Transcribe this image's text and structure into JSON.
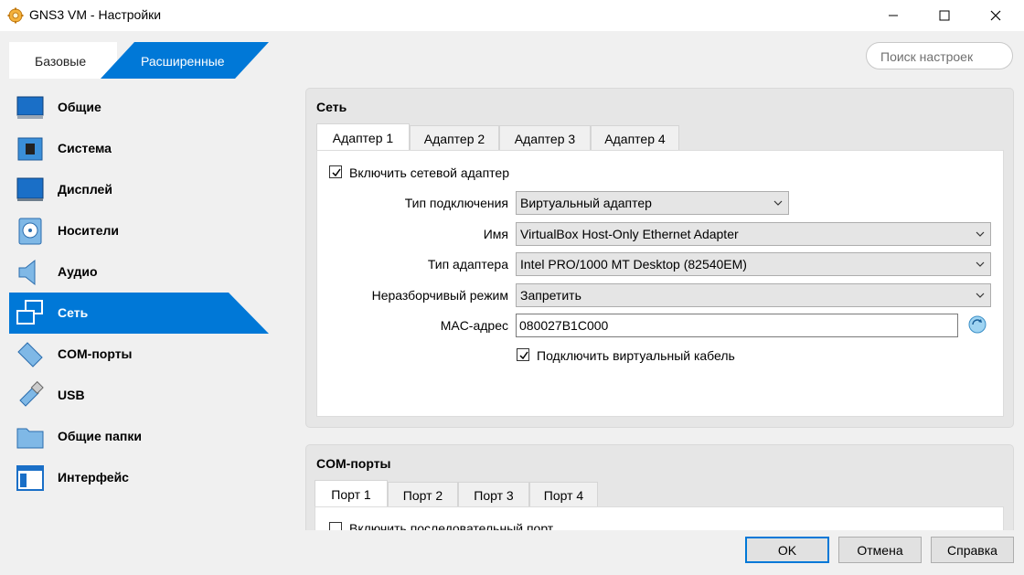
{
  "window": {
    "title": "GNS3 VM - Настройки"
  },
  "mode_tabs": {
    "basic": "Базовые",
    "advanced": "Расширенные"
  },
  "search": {
    "placeholder": "Поиск настроек"
  },
  "sidebar": {
    "items": [
      {
        "label": "Общие",
        "icon": "general-icon"
      },
      {
        "label": "Система",
        "icon": "chip-icon"
      },
      {
        "label": "Дисплей",
        "icon": "monitor-icon"
      },
      {
        "label": "Носители",
        "icon": "disk-icon"
      },
      {
        "label": "Аудио",
        "icon": "speaker-icon"
      },
      {
        "label": "Сеть",
        "icon": "network-icon",
        "selected": true
      },
      {
        "label": "COM-порты",
        "icon": "serial-port-icon"
      },
      {
        "label": "USB",
        "icon": "usb-icon"
      },
      {
        "label": "Общие папки",
        "icon": "folder-icon"
      },
      {
        "label": "Интерфейс",
        "icon": "interface-icon"
      }
    ]
  },
  "network": {
    "title": "Сеть",
    "tabs": [
      "Адаптер 1",
      "Адаптер 2",
      "Адаптер 3",
      "Адаптер 4"
    ],
    "active_tab": "Адаптер 1",
    "enable_label": "Включить сетевой адаптер",
    "enable_checked": true,
    "fields": {
      "attached_label": "Тип подключения",
      "attached_value": "Виртуальный адаптер",
      "name_label": "Имя",
      "name_value": "VirtualBox Host-Only Ethernet Adapter",
      "adapter_label": "Тип адаптера",
      "adapter_value": "Intel PRO/1000 MT Desktop (82540EM)",
      "promisc_label": "Неразборчивый режим",
      "promisc_value": "Запретить",
      "mac_label": "MAC-адрес",
      "mac_value": "080027B1C000"
    },
    "cable_label": "Подключить виртуальный кабель",
    "cable_checked": true
  },
  "com_ports": {
    "title": "COM-порты",
    "tabs": [
      "Порт 1",
      "Порт 2",
      "Порт 3",
      "Порт 4"
    ],
    "active_tab": "Порт 1",
    "enable_label": "Включить последовательный порт"
  },
  "buttons": {
    "ok": "OK",
    "cancel": "Отмена",
    "help": "Справка"
  },
  "colors": {
    "accent": "#0078d7"
  }
}
